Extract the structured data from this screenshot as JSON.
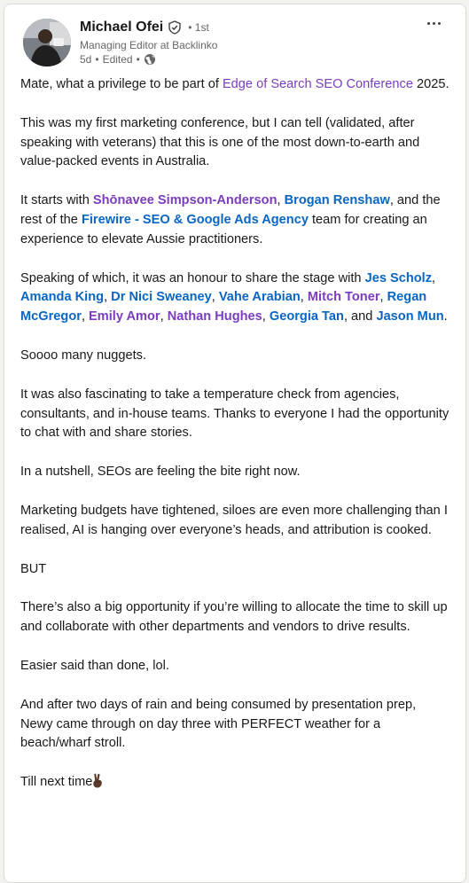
{
  "post": {
    "author": {
      "name": "Michael Ofei",
      "degree": "• 1st",
      "headline": "Managing Editor at Backlinko",
      "time": "5d",
      "edited": "Edited",
      "sep1": "•",
      "sep2": "•"
    },
    "icons": {
      "verified": "verified-shield-icon",
      "visibility": "globe-icon",
      "menu": "more-horizontal-icon",
      "emoji": "victory-hand-emoji"
    },
    "colors": {
      "mention_blue": "#0a66c2",
      "mention_purple": "#7b3dbb",
      "text": "#191919",
      "muted": "#666666"
    },
    "p1": {
      "a": "Mate, what a privilege to be part of ",
      "link": "Edge of Search SEO Conference",
      "b": " 2025."
    },
    "p2": "This was my first marketing conference, but I can tell (validated, after speaking with veterans) that this is one of the most down-to-earth and value-packed events in Australia.",
    "p3": {
      "a": "It starts with ",
      "m1": "Shōnavee Simpson-Anderson",
      "c1": ", ",
      "m2": "Brogan Renshaw",
      "b": ", and the rest of the ",
      "m3": "Firewire - SEO & Google Ads Agency",
      "c": " team for creating an experience to elevate Aussie practitioners."
    },
    "p4": {
      "a": "Speaking of which, it was an honour to share the stage with ",
      "people": [
        {
          "name": "Jes Scholz",
          "sep": ", "
        },
        {
          "name": "Amanda King",
          "sep": ", "
        },
        {
          "name": "Dr Nici Sweaney",
          "sep": ", "
        },
        {
          "name": "Vahe Arabian",
          "sep": ", "
        },
        {
          "name": "Mitch Toner",
          "sep": ", "
        },
        {
          "name": "Regan McGregor",
          "sep": ", "
        },
        {
          "name": "Emily Amor",
          "sep": ", "
        },
        {
          "name": "Nathan Hughes",
          "sep": ", "
        },
        {
          "name": "Georgia Tan",
          "sep": ", and "
        },
        {
          "name": "Jason Mun",
          "sep": "."
        }
      ]
    },
    "p5": "Soooo many nuggets.",
    "p6": "It was also fascinating to take a temperature check from agencies, consultants, and in-house teams. Thanks to everyone I had the opportunity to chat with and share stories.",
    "p7": "In a nutshell, SEOs are feeling the bite right now.",
    "p8": "Marketing budgets have tightened, siloes are even more challenging than I realised, AI is hanging over everyone’s heads, and attribution is cooked.",
    "p9": "BUT",
    "p10": "There’s also a big opportunity if you’re willing to allocate the time to skill up and collaborate with other departments and vendors to drive results.",
    "p11": "Easier said than done, lol.",
    "p12": "And after two days of rain and being consumed by presentation prep, Newy came through on day three with PERFECT weather for a beach/wharf stroll.",
    "p13": "Till next time"
  }
}
